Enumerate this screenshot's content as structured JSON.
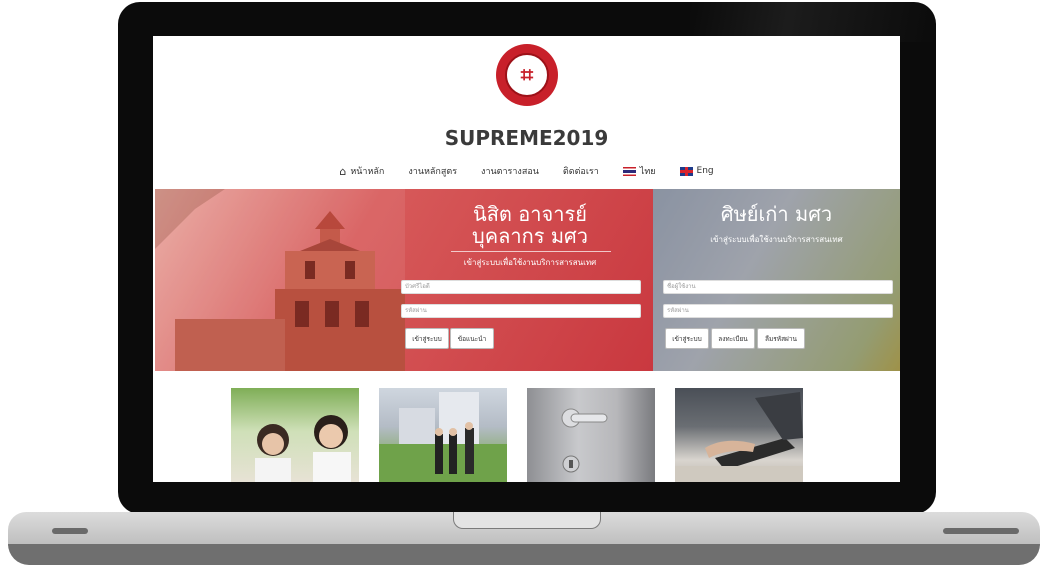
{
  "site": {
    "title": "SUPREME2019",
    "logo_glyph": "⌗"
  },
  "nav": {
    "home": "หน้าหลัก",
    "curriculum": "งานหลักสูตร",
    "schedule": "งานตารางสอน",
    "contact": "ติดต่อเรา",
    "lang_th": "ไทย",
    "lang_en": "Eng"
  },
  "login_main": {
    "heading_line1": "นิสิต อาจารย์",
    "heading_line2": "บุคลากร มศว",
    "subtitle": "เข้าสู่ระบบเพื่อใช้งานบริการสารสนเทศ",
    "username_placeholder": "บัวศรีไอดี",
    "password_placeholder": "รหัสผ่าน",
    "login_button": "เข้าสู่ระบบ",
    "help_button": "ข้อแนะนำ"
  },
  "login_alumni": {
    "heading": "ศิษย์เก่า มศว",
    "subtitle": "เข้าสู่ระบบเพื่อใช้งานบริการสารสนเทศ",
    "username_placeholder": "ชื่อผู้ใช้งาน",
    "password_placeholder": "รหัสผ่าน",
    "login_button": "เข้าสู่ระบบ",
    "register_button": "ลงทะเบียน",
    "forgot_button": "ลืมรหัสผ่าน"
  },
  "colors": {
    "brand_red": "#c8202a",
    "text_dark": "#3a3a3a"
  },
  "icons": {
    "home": "home-icon",
    "flag_th": "thai-flag-icon",
    "flag_en": "uk-flag-icon"
  }
}
